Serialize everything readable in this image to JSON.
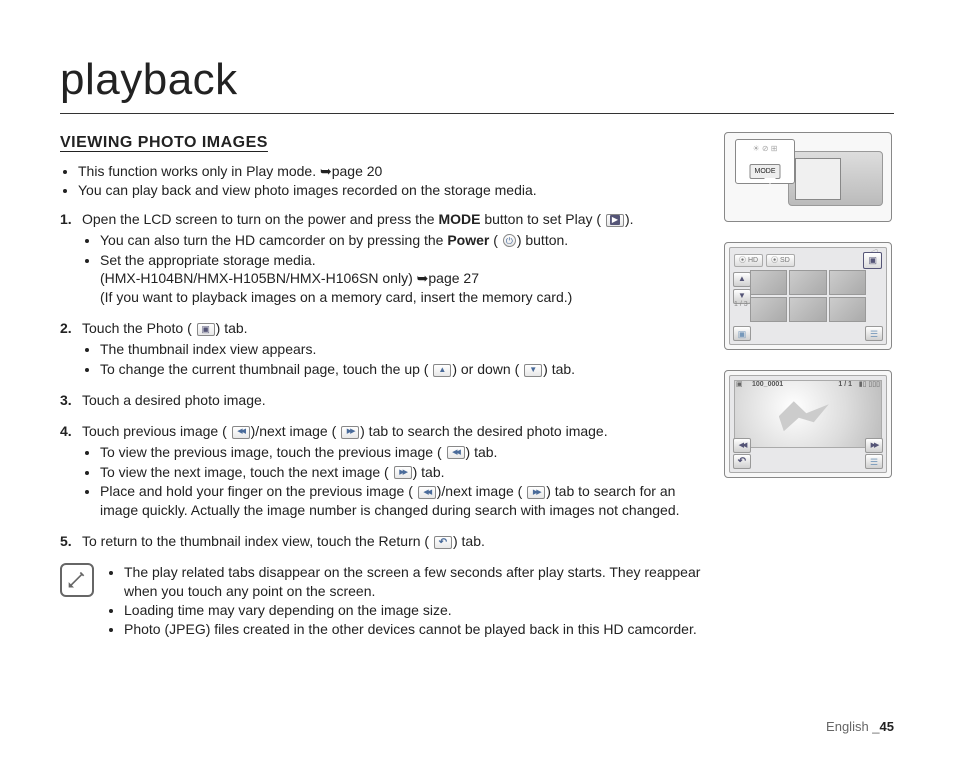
{
  "chapter_title": "playback",
  "section_title": "VIEWING PHOTO IMAGES",
  "intro": {
    "b1a": "This function works only in Play mode. ",
    "b1_ref": "➥page 20",
    "b2": "You can play back and view photo images recorded on the storage media."
  },
  "steps": {
    "s1": {
      "num": "1.",
      "line_a": "Open the LCD screen to turn on the power and press the ",
      "mode_word": "MODE",
      "line_b": " button to set Play ( ",
      "line_c": ").",
      "sub1_a": "You can also turn the HD camcorder on by pressing the ",
      "power_word": "Power",
      "sub1_b": " ( ",
      "sub1_c": ") button.",
      "sub2": "Set the appropriate storage media.",
      "sub2_note_a": "(HMX-H104BN/HMX-H105BN/HMX-H106SN only) ",
      "sub2_note_ref": "➥page 27",
      "sub2_note_b": "(If you want to playback images on a memory card, insert the memory card.)"
    },
    "s2": {
      "num": "2.",
      "line_a": "Touch the Photo ( ",
      "line_b": ") tab.",
      "sub1": "The thumbnail index view appears.",
      "sub2_a": "To change the current thumbnail page, touch the up ( ",
      "sub2_b": ") or down ( ",
      "sub2_c": ") tab."
    },
    "s3": {
      "num": "3.",
      "line": "Touch a desired photo image."
    },
    "s4": {
      "num": "4.",
      "line_a": "Touch previous image ( ",
      "line_b": ")/next image ( ",
      "line_c": ") tab to search the desired photo image.",
      "sub1_a": "To view the previous image, touch the previous image ( ",
      "sub1_b": ") tab.",
      "sub2_a": "To view the next image, touch the next image ( ",
      "sub2_b": ") tab.",
      "sub3_a": "Place and hold your finger on the previous image ( ",
      "sub3_b": ")/next image ( ",
      "sub3_c": ") tab to search for an image quickly. Actually the image number is changed during search with images not changed."
    },
    "s5": {
      "num": "5.",
      "line_a": "To return to the thumbnail index view, touch the Return ( ",
      "line_b": ") tab."
    }
  },
  "notes": {
    "n1": "The play related tabs disappear on the screen a few seconds after play starts. They reappear when you touch any point on the screen.",
    "n2": "Loading time may vary depending on the image size.",
    "n3": "Photo (JPEG) files created in the other devices cannot be played back in this HD camcorder."
  },
  "illus": {
    "mode_label": "MODE",
    "hd_tab": "HD",
    "sd_tab": "SD",
    "page_counter": "1 / 3",
    "file_id": "100_0001",
    "frame_idx": "1 / 1"
  },
  "footer": {
    "lang": "English _",
    "page": "45"
  }
}
